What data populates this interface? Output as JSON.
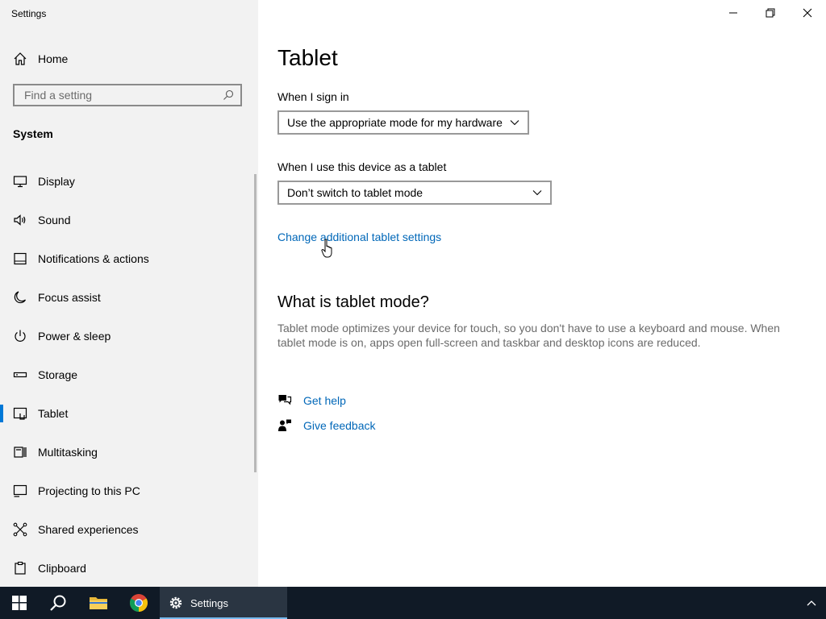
{
  "window": {
    "title": "Settings"
  },
  "sidebar": {
    "home_label": "Home",
    "search_placeholder": "Find a setting",
    "section_title": "System",
    "items": [
      {
        "label": "Display",
        "icon": "monitor-icon"
      },
      {
        "label": "Sound",
        "icon": "speaker-icon"
      },
      {
        "label": "Notifications & actions",
        "icon": "notifications-icon"
      },
      {
        "label": "Focus assist",
        "icon": "moon-icon"
      },
      {
        "label": "Power & sleep",
        "icon": "power-icon"
      },
      {
        "label": "Storage",
        "icon": "storage-icon"
      },
      {
        "label": "Tablet",
        "icon": "tablet-icon",
        "active": true
      },
      {
        "label": "Multitasking",
        "icon": "multitasking-icon"
      },
      {
        "label": "Projecting to this PC",
        "icon": "projecting-icon"
      },
      {
        "label": "Shared experiences",
        "icon": "shared-experiences-icon"
      },
      {
        "label": "Clipboard",
        "icon": "clipboard-icon"
      }
    ]
  },
  "main": {
    "title": "Tablet",
    "sign_in_label": "When I sign in",
    "sign_in_value": "Use the appropriate mode for my hardware",
    "device_label": "When I use this device as a tablet",
    "device_value": "Don’t switch to tablet mode",
    "additional_link": "Change additional tablet settings",
    "what_title": "What is tablet mode?",
    "what_desc": "Tablet mode optimizes your device for touch, so you don't have to use a keyboard and mouse. When tablet mode is on, apps open full-screen and taskbar and desktop icons are reduced.",
    "get_help": "Get help",
    "give_feedback": "Give feedback"
  },
  "taskbar": {
    "active_app_label": "Settings"
  },
  "colors": {
    "accent": "#0078d7",
    "link": "#0067b8",
    "sidebar_bg": "#f2f2f2",
    "taskbar_bg": "#101a26"
  }
}
